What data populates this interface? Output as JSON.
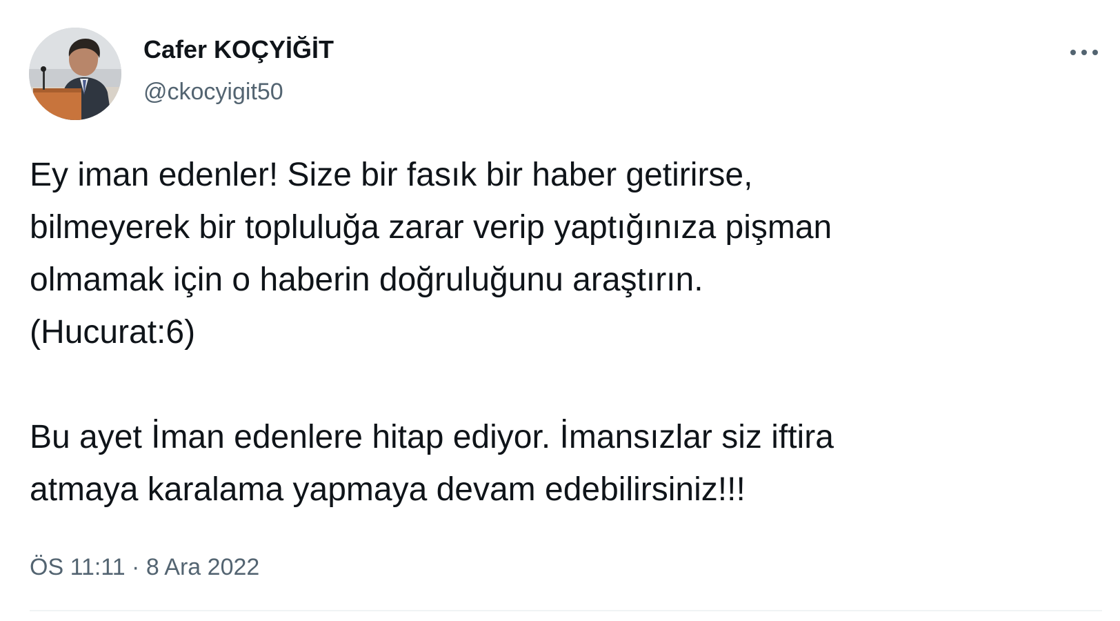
{
  "author": {
    "display_name": "Cafer KOÇYİĞİT",
    "handle": "@ckocyigit50"
  },
  "tweet": {
    "paragraph1_lines": [
      "Ey iman edenler! Size bir fasık bir haber getirirse,",
      "bilmeyerek bir topluluğa zarar verip yaptığınıza pişman",
      "olmamak için o haberin doğruluğunu araştırın.",
      "(Hucurat:6)"
    ],
    "paragraph2_lines": [
      "Bu ayet İman edenlere hitap ediyor. İmansızlar siz iftira",
      "atmaya karalama yapmaya devam edebilirsiniz!!!"
    ],
    "timestamp": "ÖS 11:11 · 8 Ara 2022"
  },
  "icons": {
    "more": "more-horizontal-icon",
    "avatar": "profile-photo"
  },
  "colors": {
    "text_primary": "#0f1419",
    "text_secondary": "#536471",
    "divider": "#eff3f4",
    "background": "#ffffff"
  }
}
